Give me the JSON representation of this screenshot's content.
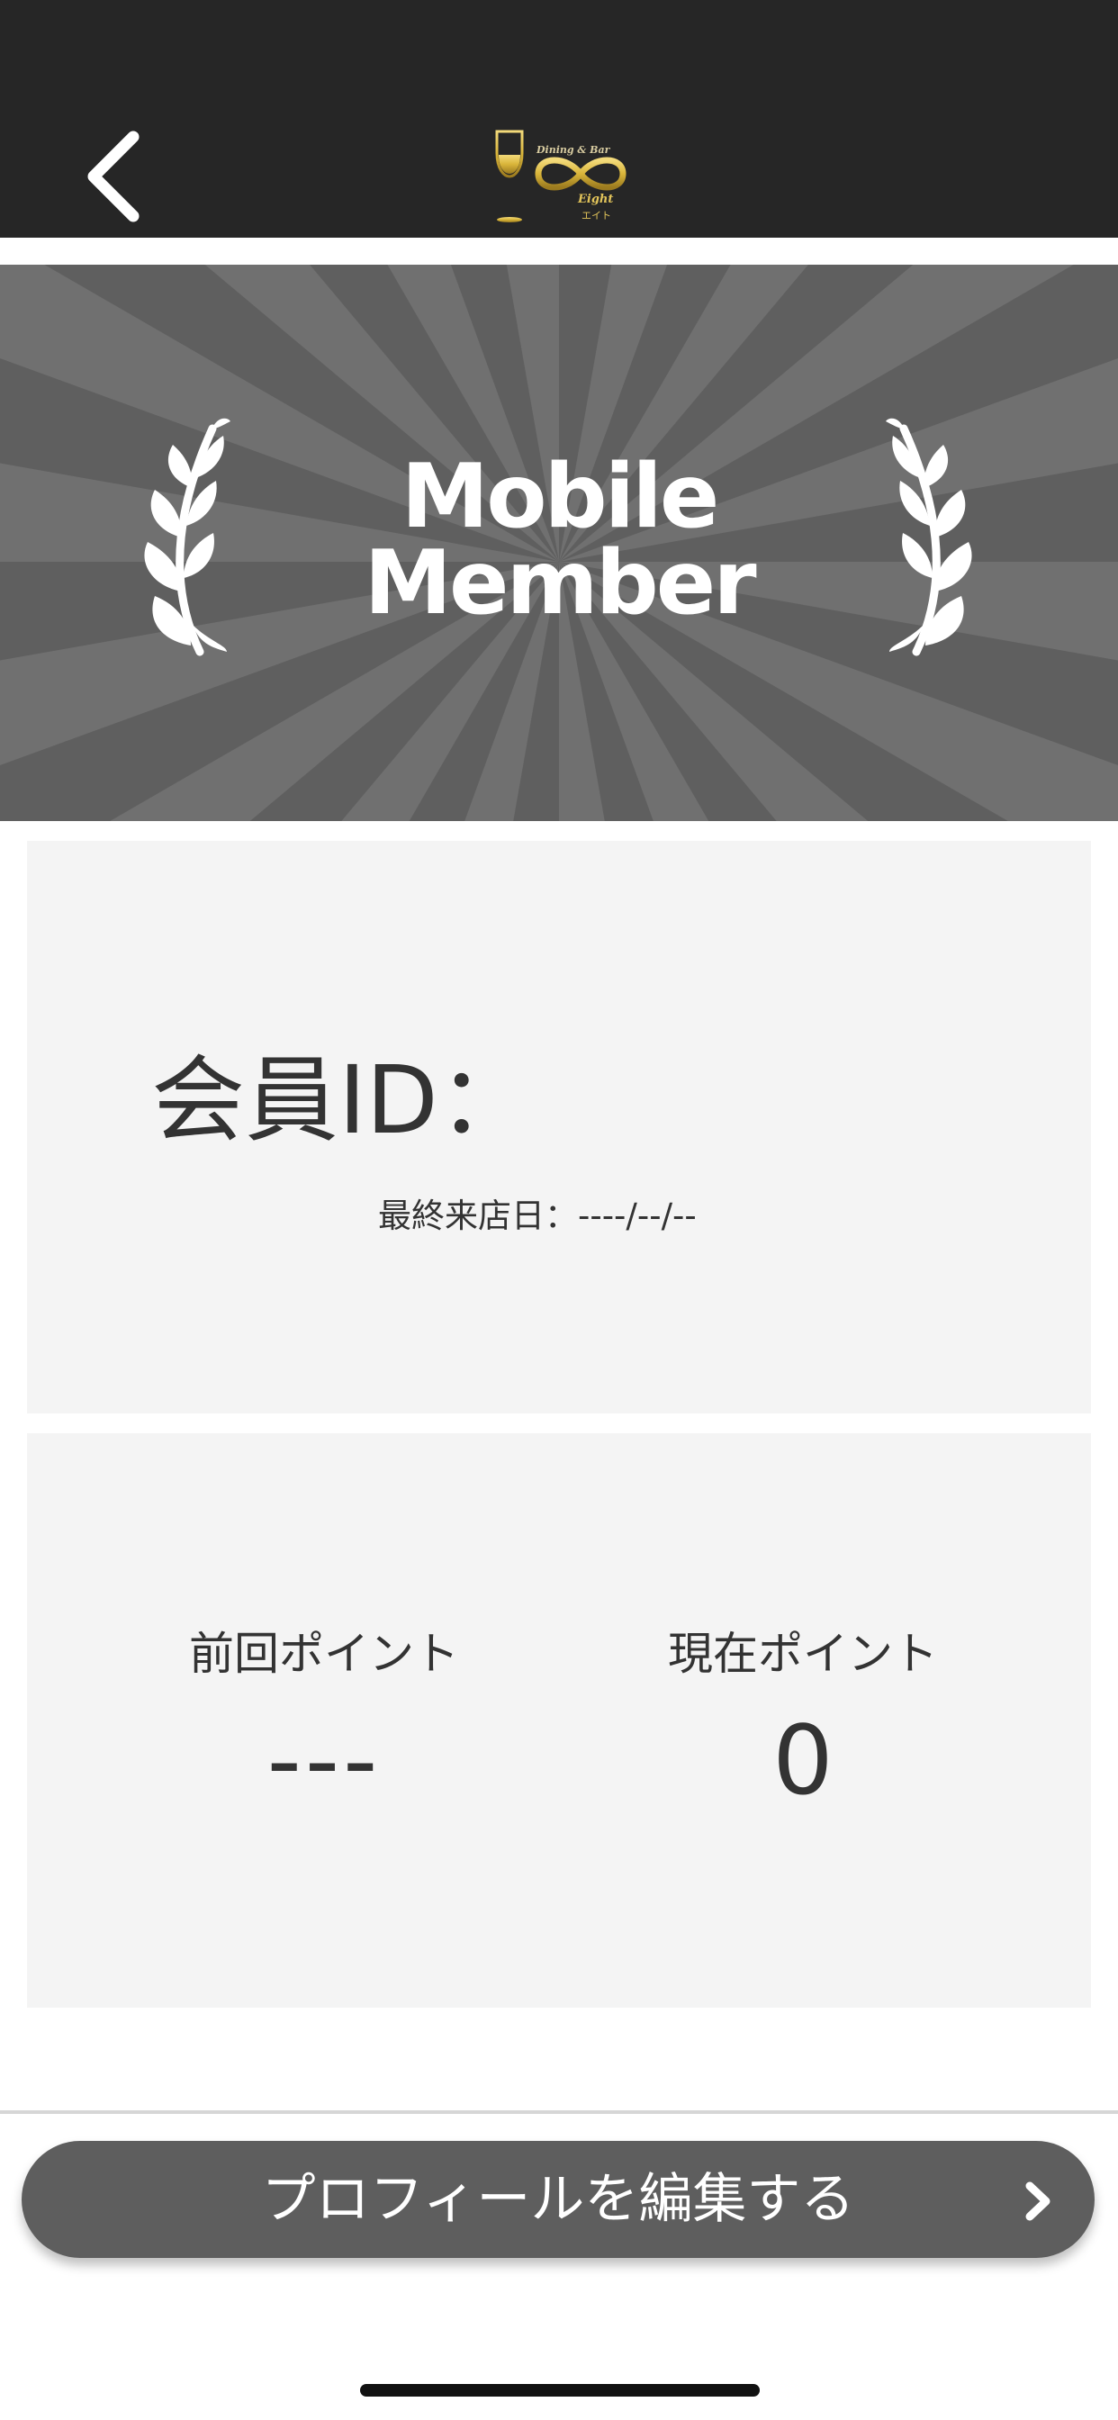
{
  "header": {
    "logo": {
      "line1": "Dining & Bar",
      "line2": "Eight",
      "line3": "エイト"
    }
  },
  "banner": {
    "title_line1": "Mobile",
    "title_line2": "Member"
  },
  "member_card": {
    "member_id_label": "会員ID：",
    "last_visit": "最終来店日：----/--/--"
  },
  "points": {
    "previous_label": "前回ポイント",
    "previous_value": "---",
    "current_label": "現在ポイント",
    "current_value": "0"
  },
  "edit_profile_button": {
    "label": "プロフィールを編集する"
  },
  "colors": {
    "header_bg": "#262626",
    "banner_dark": "#5f5f5f",
    "banner_light": "#707070",
    "card_bg": "#f4f4f4",
    "button_bg": "#5e5e5e",
    "logo_gold": "#d9b53a"
  },
  "icons": {
    "back": "chevron-left-icon",
    "button_arrow": "chevron-right-icon",
    "banner_decoration": "laurel-icon",
    "logo": "wine-glass-infinity-logo"
  }
}
